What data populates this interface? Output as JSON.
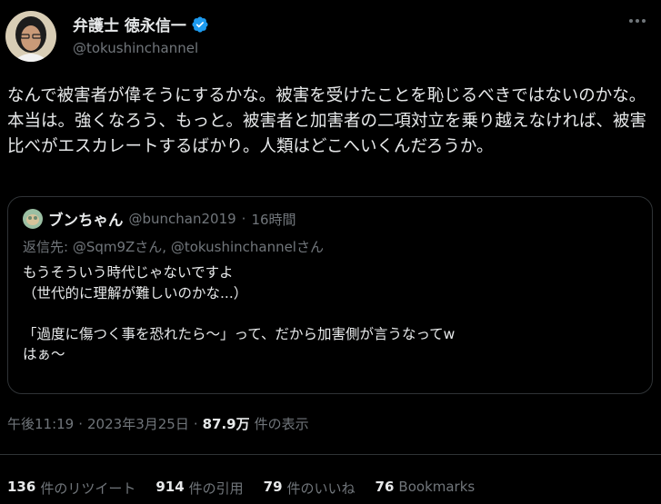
{
  "author": {
    "display_name": "弁護士 徳永信一",
    "handle": "@tokushinchannel",
    "verified": true,
    "brand_color": "#1d9bf0"
  },
  "tweet": {
    "text": "なんで被害者が偉そうにするかな。被害を受けたことを恥じるべきではないのかな。本当は。強くなろう、もっと。被害者と加害者の二項対立を乗り越えなければ、被害比べがエスカレートするばかり。人類はどこへいくんだろうか。"
  },
  "quoted": {
    "display_name": "ブンちゃん",
    "handle": "@bunchan2019",
    "separator": "·",
    "time": "16時間",
    "reply_to": "返信先: @Sqm9Zさん, @tokushinchannelさん",
    "text": "もうそういう時代じゃないですよ\n（世代的に理解が難しいのかな...）\n\n「過度に傷つく事を恐れたら～」って、だから加害側が言うなってw\nはぁ～"
  },
  "meta": {
    "time": "午後11:19",
    "dot1": "·",
    "date": "2023年3月25日",
    "dot2": "·",
    "views": "87.9万",
    "views_label": "件の表示"
  },
  "stats": {
    "retweets_num": "136",
    "retweets_label": "件のリツイート",
    "quotes_num": "914",
    "quotes_label": "件の引用",
    "likes_num": "79",
    "likes_label": "件のいいね",
    "bookmarks_num": "76",
    "bookmarks_label": "Bookmarks"
  }
}
